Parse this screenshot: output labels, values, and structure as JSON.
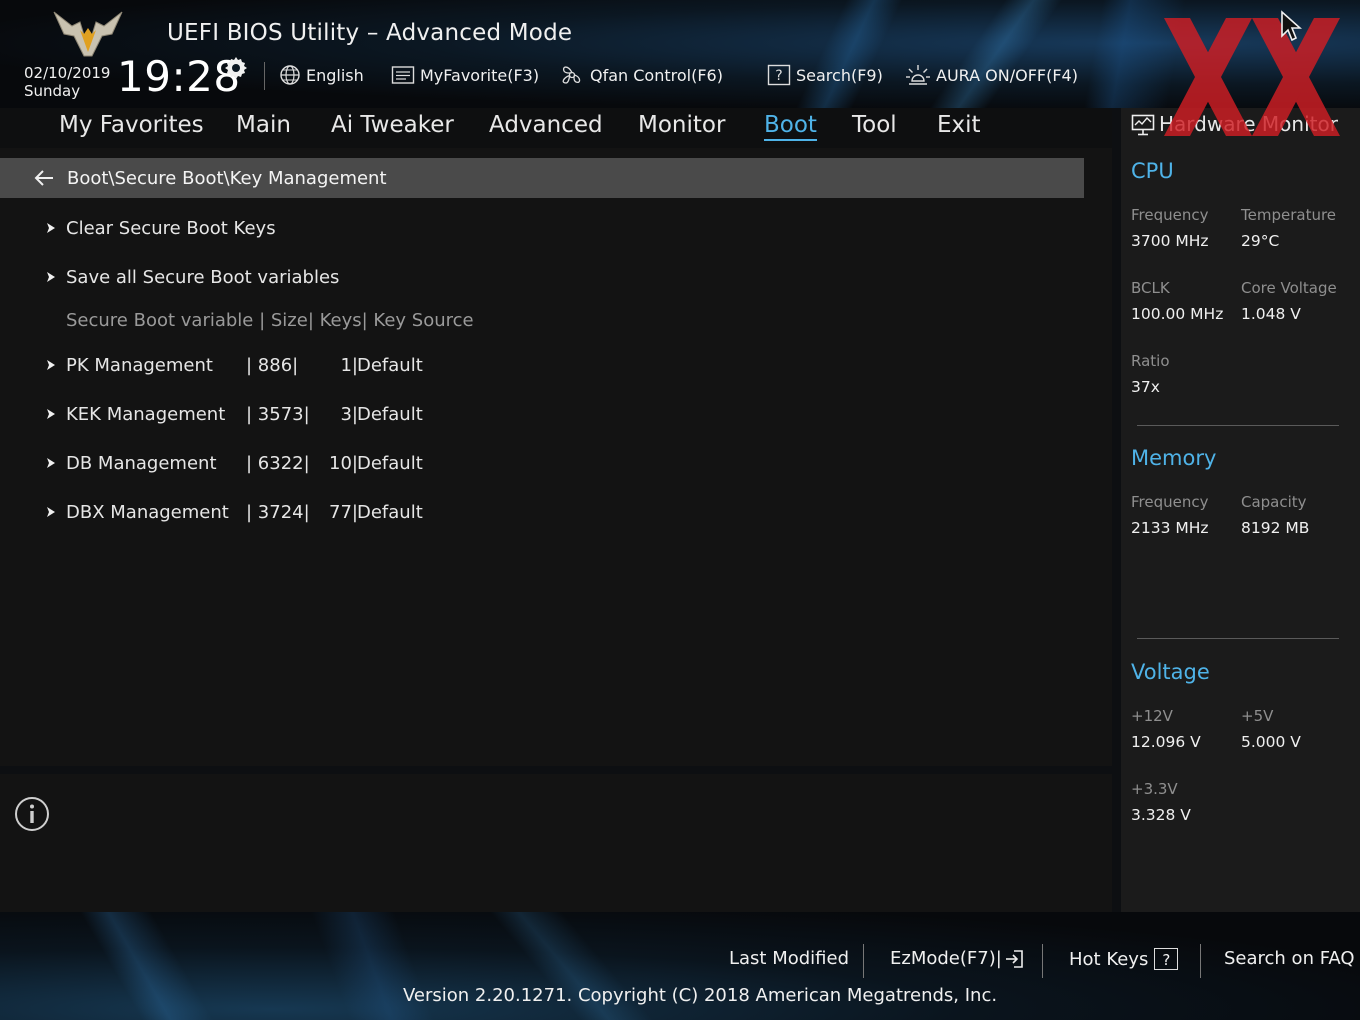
{
  "header": {
    "title": "UEFI BIOS Utility – Advanced Mode",
    "date": "02/10/2019",
    "day": "Sunday",
    "time": "19:28",
    "language": "English",
    "myfavorite": "MyFavorite(F3)",
    "qfan": "Qfan Control(F6)",
    "search": "Search(F9)",
    "aura": "AURA ON/OFF(F4)"
  },
  "menu": {
    "items": [
      "My Favorites",
      "Main",
      "Ai Tweaker",
      "Advanced",
      "Monitor",
      "Boot",
      "Tool",
      "Exit"
    ],
    "active": "Boot"
  },
  "breadcrumb": "Boot\\Secure Boot\\Key Management",
  "actions": [
    "Clear Secure Boot Keys",
    "Save all Secure Boot variables"
  ],
  "column_header": "Secure Boot variable  |  Size|  Keys|  Key Source",
  "keys": [
    {
      "label": "PK Management",
      "size": "|  886|",
      "keys": "1|",
      "source": "Default"
    },
    {
      "label": "KEK Management",
      "size": "| 3573|",
      "keys": "3|",
      "source": "Default"
    },
    {
      "label": "DB Management",
      "size": "| 6322|",
      "keys": "10|",
      "source": "Default"
    },
    {
      "label": "DBX Management",
      "size": "| 3724|",
      "keys": "77|",
      "source": "Default"
    }
  ],
  "hw_monitor": {
    "title": "Hardware Monitor",
    "cpu": {
      "title": "CPU",
      "frequency_label": "Frequency",
      "frequency": "3700 MHz",
      "temperature_label": "Temperature",
      "temperature": "29°C",
      "bclk_label": "BCLK",
      "bclk": "100.00 MHz",
      "core_voltage_label": "Core Voltage",
      "core_voltage": "1.048 V",
      "ratio_label": "Ratio",
      "ratio": "37x"
    },
    "memory": {
      "title": "Memory",
      "frequency_label": "Frequency",
      "frequency": "2133 MHz",
      "capacity_label": "Capacity",
      "capacity": "8192 MB"
    },
    "voltage": {
      "title": "Voltage",
      "v12_label": "+12V",
      "v12": "12.096 V",
      "v5_label": "+5V",
      "v5": "5.000 V",
      "v33_label": "+3.3V",
      "v33": "3.328 V"
    }
  },
  "footer": {
    "last_modified": "Last Modified",
    "ezmode": "EzMode(F7)|",
    "hot_keys": "Hot Keys",
    "hot_keys_glyph": "?",
    "search_faq": "Search on FAQ",
    "version": "Version 2.20.1271. Copyright (C) 2018 American Megatrends, Inc."
  },
  "colors": {
    "accent": "#4fb3e8",
    "watermark": "#d01e24"
  }
}
